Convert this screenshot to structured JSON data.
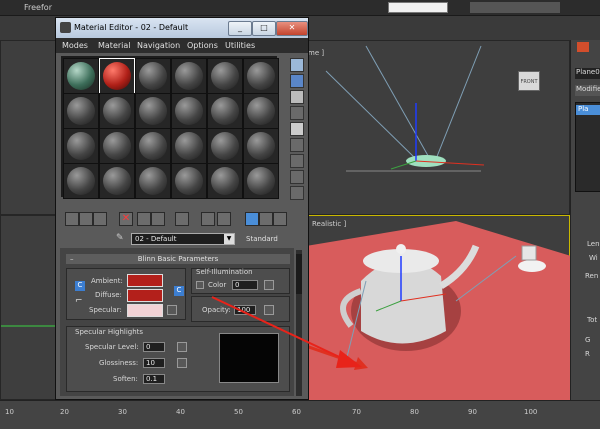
{
  "app": {
    "toolbar_label": "Freefor",
    "viewport_top_label": "me ]",
    "viewport_persp_label": "Realistic ]",
    "viewcube_label": "FRONT",
    "right_panel": {
      "object_name": "Plane0",
      "modifier_label": "Modifie",
      "item": "Pla",
      "frag1": "Len",
      "frag2": "Wi",
      "frag3": "Ren",
      "frag4": "Tot",
      "frag5": "G",
      "frag6": "R"
    },
    "ruler_ticks": [
      "10",
      "20",
      "30",
      "40",
      "50",
      "60",
      "70",
      "80",
      "90",
      "100"
    ]
  },
  "window": {
    "title": "Material Editor - 02 - Default",
    "minimize": "_",
    "maximize": "□",
    "close": "✕",
    "menu": [
      "Modes",
      "Material",
      "Navigation",
      "Options",
      "Utilities"
    ]
  },
  "material": {
    "name": "02 - Default",
    "type_button": "Standard"
  },
  "blinn": {
    "title": "Blinn Basic Parameters",
    "ambient_label": "Ambient:",
    "diffuse_label": "Diffuse:",
    "specular_label": "Specular:",
    "lock_button": "C",
    "map_button": "C",
    "self_illum_title": "Self-Illumination",
    "color_label": "Color",
    "color_value": "0",
    "opacity_label": "Opacity:",
    "opacity_value": "100",
    "ambient_color": "#b3201b",
    "diffuse_color": "#b3201b",
    "specular_color": "#f2d2d5"
  },
  "specular_highlights": {
    "title": "Specular Highlights",
    "level_label": "Specular Level:",
    "level_value": "0",
    "gloss_label": "Glossiness:",
    "gloss_value": "10",
    "soften_label": "Soften:",
    "soften_value": "0.1"
  }
}
